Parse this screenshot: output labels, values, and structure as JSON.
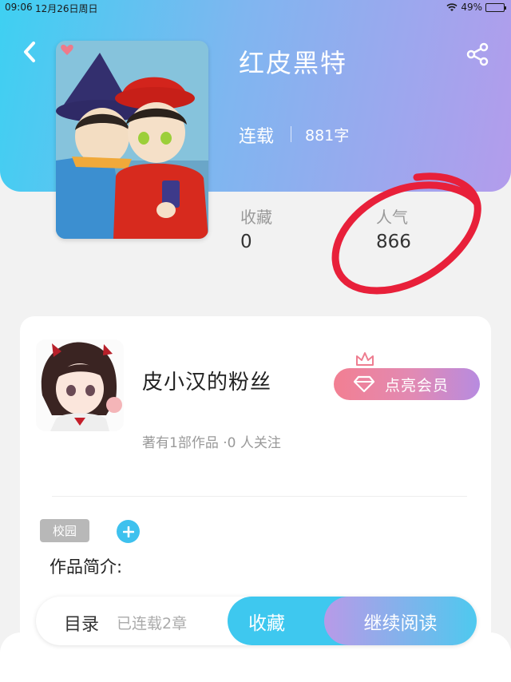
{
  "status": {
    "time": "09:06",
    "date": "12月26日周日",
    "battery": "49%",
    "battery_level": 0.49
  },
  "book": {
    "title": "红皮黑特",
    "status": "连载",
    "word_count": "881字"
  },
  "stats": {
    "favorites_label": "收藏",
    "favorites_value": "0",
    "popularity_label": "人气",
    "popularity_value": "866"
  },
  "author": {
    "name": "皮小汉的粉丝",
    "meta": "著有1部作品 ·0 人关注",
    "vip_label": "点亮会员"
  },
  "tags": {
    "items": [
      "校园"
    ]
  },
  "intro": {
    "label": "作品简介:"
  },
  "bottom_bar": {
    "catalog": "目录",
    "chapters": "已连载2章",
    "collect": "收藏",
    "continue": "继续阅读"
  },
  "colors": {
    "header_start": "#3ed0f2",
    "header_end": "#b39cec",
    "accent_blue": "#3ec8ef",
    "vip_pink": "#f27f92",
    "annotation_red": "#e8203a"
  },
  "icons": {
    "back": "chevron-left-icon",
    "share": "share-icon",
    "crown": "crown-icon",
    "diamond": "diamond-icon",
    "plus": "plus-icon",
    "wifi": "wifi-icon",
    "battery": "battery-icon"
  }
}
